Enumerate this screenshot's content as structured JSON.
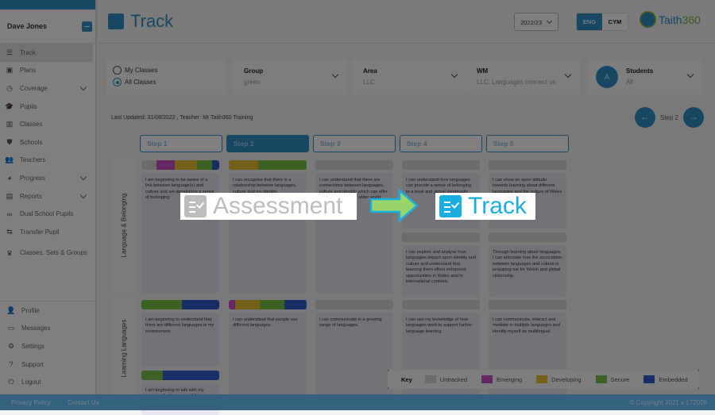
{
  "sidebar": {
    "user_name": "Dave Jones",
    "items": [
      {
        "label": "Track",
        "icon": "track-icon",
        "active": true
      },
      {
        "label": "Plans",
        "icon": "plans-icon"
      },
      {
        "label": "Coverage",
        "icon": "coverage-icon",
        "expandable": true
      },
      {
        "label": "Pupils",
        "icon": "graduation-cap-icon"
      },
      {
        "label": "Classes",
        "icon": "classes-icon"
      },
      {
        "label": "Schools",
        "icon": "shield-icon"
      },
      {
        "label": "Teachers",
        "icon": "teachers-icon"
      },
      {
        "label": "Progress",
        "icon": "progress-icon",
        "expandable": true
      },
      {
        "label": "Reports",
        "icon": "reports-icon",
        "expandable": true
      },
      {
        "label": "Dual School Pupils",
        "icon": "link-icon"
      },
      {
        "label": "Transfer Pupil",
        "icon": "transfer-icon"
      },
      {
        "label": "Classes, Sets & Groups",
        "icon": "trophy-icon"
      }
    ],
    "bottom_items": [
      {
        "label": "Profile",
        "icon": "person-icon"
      },
      {
        "label": "Messages",
        "icon": "message-icon"
      },
      {
        "label": "Settings",
        "icon": "gear-icon"
      },
      {
        "label": "Support",
        "icon": "support-icon"
      },
      {
        "label": "Logout",
        "icon": "power-icon"
      }
    ]
  },
  "header": {
    "title": "Track",
    "year": "2022/23",
    "lang_eng": "ENG",
    "lang_cym": "CYM",
    "logo_text_a": "Taith",
    "logo_text_b": "360"
  },
  "filters": {
    "my_classes": "My Classes",
    "all_classes": "All Classes",
    "group_label": "Group",
    "group_value": "green",
    "area_label": "Area",
    "area_value": "LLC",
    "wm_label": "WM",
    "wm_value": "LLC: Languages connect us",
    "students_label": "Students",
    "students_value": "All",
    "avatar_letter": "A"
  },
  "last_updated": "Last Updated: 31/08/2022 , Teacher: Mr Taith360 Training",
  "step_nav": {
    "label": "Step 2",
    "prev": "←",
    "next": "→"
  },
  "steps": [
    "Step 1",
    "Step 2",
    "Step 3",
    "Step 4",
    "Step 5"
  ],
  "selected_step": 1,
  "rows": [
    {
      "label": "Language & Belonging",
      "cells": [
        [
          {
            "text": "I am beginning to be aware of a link between language(s) and culture and am developing a sense of belonging",
            "bar": [
              [
                "untracked",
                0.19
              ],
              [
                "emerging",
                0.24
              ],
              [
                "developing",
                0.28
              ],
              [
                "secure",
                0.2
              ],
              [
                "embedded",
                0.09
              ]
            ]
          }
        ],
        [
          {
            "text": "I can recognise that there is a relationship between languages, culture and my identity",
            "bar": [
              [
                "developing",
                0.38
              ],
              [
                "secure",
                0.62
              ]
            ]
          }
        ],
        [
          {
            "text": "I can understand that there are connections between languages, culture and identity which can offer opportunities in the wider world",
            "bar": [
              [
                "untracked",
                1
              ]
            ]
          }
        ],
        [
          {
            "text": "I can understand how languages can provide a sense of belonging to a local and global community",
            "bar": [
              [
                "untracked",
                1
              ]
            ]
          },
          {
            "text": "I can explore and analyse how languages impact upon identity and culture and understand that learning them offers enhanced opportunities in Wales and in international contexts.",
            "bar": [
              [
                "untracked",
                1
              ]
            ]
          }
        ],
        [
          {
            "text": "I can show an open attitude towards learning about different languages and the culture of Wales",
            "bar": [
              [
                "untracked",
                1
              ]
            ]
          },
          {
            "text": "Through learning about languages, I can articulate how the association between languages and culture is preparing me for Welsh and global citizenship.",
            "bar": [
              [
                "untracked",
                1
              ]
            ]
          }
        ]
      ]
    },
    {
      "label": "Learning Languages",
      "cells": [
        [
          {
            "text": "I am beginning to understand that there are different languages in my environment.",
            "bar": [
              [
                "secure",
                0.52
              ],
              [
                "embedded",
                0.48
              ]
            ]
          },
          {
            "text": "I am beginning to talk with my peers in the language of the setting/school",
            "bar": [
              [
                "secure",
                0.28
              ],
              [
                "embedded",
                0.72
              ]
            ]
          }
        ],
        [
          {
            "text": "I can understand that people use different languages.",
            "bar": [
              [
                "emerging",
                0.08
              ],
              [
                "developing",
                0.32
              ],
              [
                "secure",
                0.31
              ],
              [
                "embedded",
                0.29
              ]
            ]
          }
        ],
        [
          {
            "text": "I can communicate in a growing range of languages.",
            "bar": [
              [
                "untracked",
                1
              ]
            ]
          }
        ],
        [
          {
            "text": "I can use my knowledge of how languages work to support further language learning.",
            "bar": [
              [
                "untracked",
                1
              ]
            ]
          }
        ],
        [
          {
            "text": "I can communicate, interact and mediate in multiple languages and identify myself as multilingual.",
            "bar": [
              [
                "untracked",
                1
              ]
            ]
          }
        ]
      ]
    }
  ],
  "key": {
    "title": "Key",
    "items": [
      {
        "label": "Untracked",
        "color": "#d7d7d7"
      },
      {
        "label": "Emerging",
        "color": "#c94fc6"
      },
      {
        "label": "Developing",
        "color": "#e6c232"
      },
      {
        "label": "Secure",
        "color": "#7bc24a"
      },
      {
        "label": "Embedded",
        "color": "#2f5fcf"
      }
    ]
  },
  "status_colors": {
    "untracked": "#d7d7d7",
    "emerging": "#c94fc6",
    "developing": "#e6c232",
    "secure": "#7bc24a",
    "embedded": "#2f5fcf"
  },
  "footer": {
    "privacy": "Privacy Policy",
    "contact": "Contact Us",
    "copyright": "© Copyright 2021 v 172026"
  },
  "callout": {
    "from_label": "Assessment",
    "to_label": "Track",
    "from_color": "#bdbdbd",
    "to_color": "#1aaee0",
    "arrow_color": "#98d56a"
  }
}
